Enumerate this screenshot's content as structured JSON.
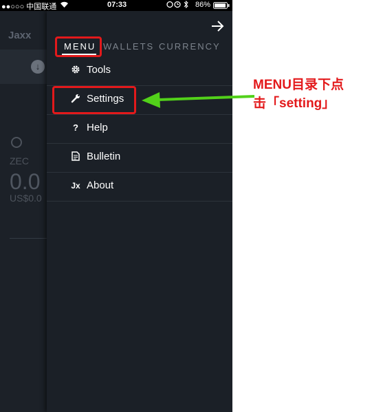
{
  "status_bar": {
    "carrier": "●●○○○ 中国联通",
    "time": "07:33",
    "battery": "86%"
  },
  "background_app": {
    "logo": "Jaxx",
    "coin": "ZEC",
    "balance": "0.0",
    "fiat": "US$0.0"
  },
  "drawer": {
    "tabs": [
      {
        "label": "MENU",
        "active": true
      },
      {
        "label": "WALLETS",
        "active": false
      },
      {
        "label": "CURRENCY",
        "active": false
      }
    ],
    "items": [
      {
        "label": "Tools",
        "icon": "gear-icon"
      },
      {
        "label": "Settings",
        "icon": "wrench-icon"
      },
      {
        "label": "Help",
        "icon": "question-icon"
      },
      {
        "label": "Bulletin",
        "icon": "document-icon"
      },
      {
        "label": "About",
        "icon": "jaxx-logo-icon"
      }
    ]
  },
  "annotation": {
    "line1": "MENU目录下点",
    "line2": "击「setting」",
    "color": "#e3191b",
    "arrow_color": "#52d11a"
  }
}
